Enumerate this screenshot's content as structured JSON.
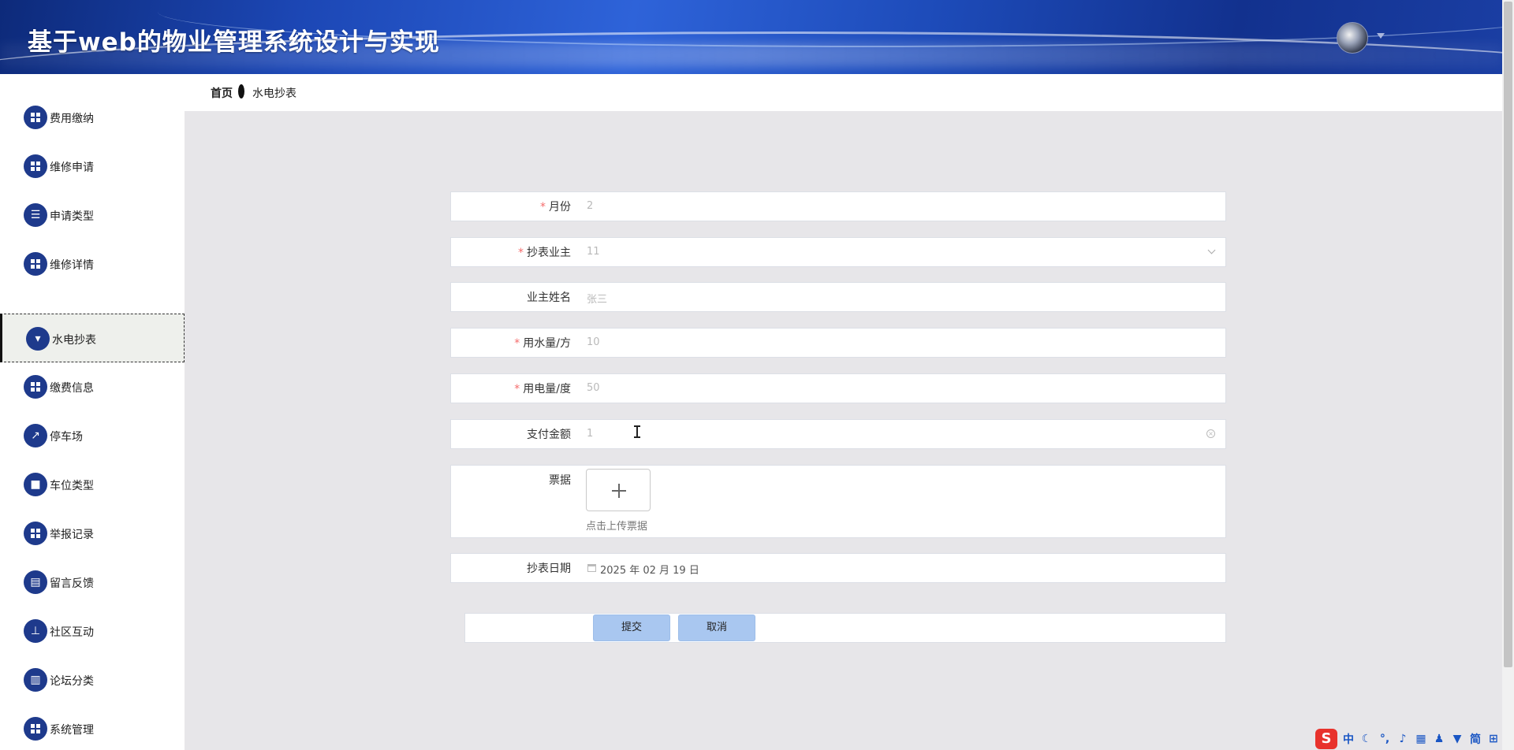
{
  "app": {
    "title": "基于web的物业管理系统设计与实现"
  },
  "breadcrumb": {
    "home": "首页",
    "current": "水电抄表"
  },
  "sidebar": {
    "items": [
      {
        "label": "费用缴纳",
        "icon": "grid-icon"
      },
      {
        "label": "维修申请",
        "icon": "grid-icon"
      },
      {
        "label": "申请类型",
        "icon": "list-icon"
      },
      {
        "label": "维修详情",
        "icon": "grid-icon"
      },
      {
        "label": "水电抄表",
        "icon": "brush-icon",
        "active": true
      },
      {
        "label": "缴费信息",
        "icon": "grid-icon"
      },
      {
        "label": "停车场",
        "icon": "chart-icon"
      },
      {
        "label": "车位类型",
        "icon": "chat-icon"
      },
      {
        "label": "举报记录",
        "icon": "grid-icon"
      },
      {
        "label": "留言反馈",
        "icon": "clipboard-icon"
      },
      {
        "label": "社区互动",
        "icon": "stamp-icon"
      },
      {
        "label": "论坛分类",
        "icon": "bar-chart-icon"
      },
      {
        "label": "系统管理",
        "icon": "grid-icon"
      }
    ]
  },
  "form": {
    "month": {
      "label": "月份",
      "required": true,
      "value": "2"
    },
    "owner": {
      "label": "抄表业主",
      "required": true,
      "value": "11"
    },
    "owner_name": {
      "label": "业主姓名",
      "required": false,
      "value": "张三"
    },
    "water": {
      "label": "用水量/方",
      "required": true,
      "value": "10"
    },
    "electric": {
      "label": "用电量/度",
      "required": true,
      "value": "50"
    },
    "amount": {
      "label": "支付金额",
      "required": false,
      "value": "1"
    },
    "receipt": {
      "label": "票据",
      "upload_hint": "点击上传票据"
    },
    "date": {
      "label": "抄表日期",
      "value": "2025 年 02 月 19 日"
    },
    "required_mark": "*"
  },
  "buttons": {
    "submit": "提交",
    "cancel": "取消"
  },
  "ime": {
    "logo": "S",
    "lang": "中",
    "mode": "简"
  },
  "colors": {
    "header": "#1c47b5",
    "icon_bg": "#1e3a8c",
    "button": "#a9c7f0",
    "required": "#f56c6c"
  }
}
